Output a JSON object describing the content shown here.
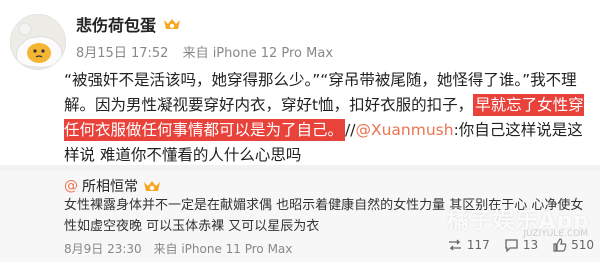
{
  "post": {
    "author": "悲伤荷包蛋",
    "date": "8月15日 17:52",
    "source": "来自 iPhone 12 Pro Max",
    "content_part1": "“被强奸不是活该吗，她穿得那么少。”“穿吊带被尾随，她怪得了谁。”我不理解。因为男性凝视要穿好内衣，穿好t恤，扣好衣服的扣子，",
    "content_highlight": "早就忘了女性穿任何衣服做任何事情都可以是为了自己。",
    "content_sep": "//",
    "mention": "@Xuanmush",
    "content_part2": ":你自己这样说是这样说 难道你不懂看的人什么心思吗"
  },
  "repost": {
    "author_prefix": "@",
    "author": "所相恒常",
    "text": "女性裸露身体并不一定是在献媚求偶 也昭示着健康自然的女性力量 其区别在于心 心净使女性如虚空夜晚 可以玉体赤裸 又可以星辰为衣",
    "date": "8月9日 23:30",
    "source": "来自 iPhone 11 Pro Max",
    "actions": {
      "repost_count": "117",
      "comment_count": "13",
      "like_count": "510"
    }
  },
  "watermark": {
    "main": "橘子娱乐App",
    "sub": "JUZIYULE.COM"
  },
  "colors": {
    "highlight": "#e8423a",
    "mention": "#eb7350",
    "repost_bg": "#f7f7f7"
  },
  "icons": [
    "avatar-egg-icon",
    "vip-badge-icon",
    "repost-icon",
    "comment-icon",
    "like-icon"
  ]
}
